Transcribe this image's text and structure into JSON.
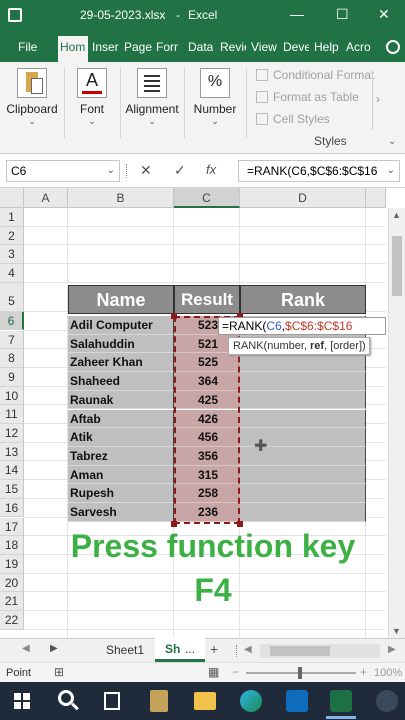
{
  "window": {
    "autosave_icon": "excel-save-icon",
    "filename": "29-05-2023.xlsx",
    "separator": "-",
    "app_name": "Excel",
    "minimize_glyph": "—",
    "maximize_glyph": "☐",
    "close_glyph": "✕"
  },
  "ribbon_tabs": [
    "File",
    "Hom",
    "Inser",
    "Page",
    "Forr",
    "Data",
    "Revie",
    "View",
    "Deve",
    "Help",
    "Acro"
  ],
  "ribbon": {
    "clipboard": "Clipboard",
    "font": "Font",
    "alignment": "Alignment",
    "number": "Number",
    "conditional_formatting": "Conditional Format",
    "format_as_table": "Format as Table",
    "cell_styles": "Cell Styles",
    "styles_group": "Styles",
    "font_glyph": "A",
    "number_glyph": "%"
  },
  "formula_bar": {
    "name_box": "C6",
    "cancel_glyph": "✕",
    "enter_glyph": "✓",
    "fx": "fx",
    "formula": "=RANK(C6,$C$6:$C$16"
  },
  "columns": [
    "A",
    "B",
    "C",
    "D"
  ],
  "rows": [
    "1",
    "2",
    "3",
    "4",
    "5",
    "6",
    "7",
    "8",
    "9",
    "10",
    "11",
    "12",
    "13",
    "14",
    "15",
    "16",
    "17",
    "18",
    "19",
    "20",
    "21",
    "22"
  ],
  "table": {
    "headers": {
      "name": "Name",
      "result": "Result",
      "rank": "Rank"
    },
    "names": [
      "Adil Computer",
      "Salahuddin",
      "Zaheer Khan",
      "Shaheed",
      "Raunak",
      "Aftab",
      "Atik",
      "Tabrez",
      "Aman",
      "Rupesh",
      "Sarvesh"
    ],
    "results": [
      "523",
      "521",
      "525",
      "364",
      "425",
      "426",
      "456",
      "356",
      "315",
      "258",
      "236"
    ]
  },
  "editing": {
    "prefix": "=RANK(",
    "ref1": "C6",
    "comma": ",",
    "ref2": "$C$6:$C$16",
    "tooltip_pre": "RANK(number, ",
    "tooltip_bold": "ref",
    "tooltip_post": ", [order])"
  },
  "overlay": {
    "line1": "Press function key",
    "line2": "F4"
  },
  "sheet_tabs": {
    "sheet1": "Sheet1",
    "active": "Sh",
    "more": "...",
    "add": "+"
  },
  "status": {
    "mode": "Point",
    "zoom": "100%"
  },
  "colors": {
    "excel_green": "#217346",
    "overlay_green": "#3cb043",
    "ref_blue": "#2f5fc4",
    "ref_red": "#c0392b",
    "name_fill": "#bfbfbf",
    "result_fill": "#c8a6a6"
  }
}
